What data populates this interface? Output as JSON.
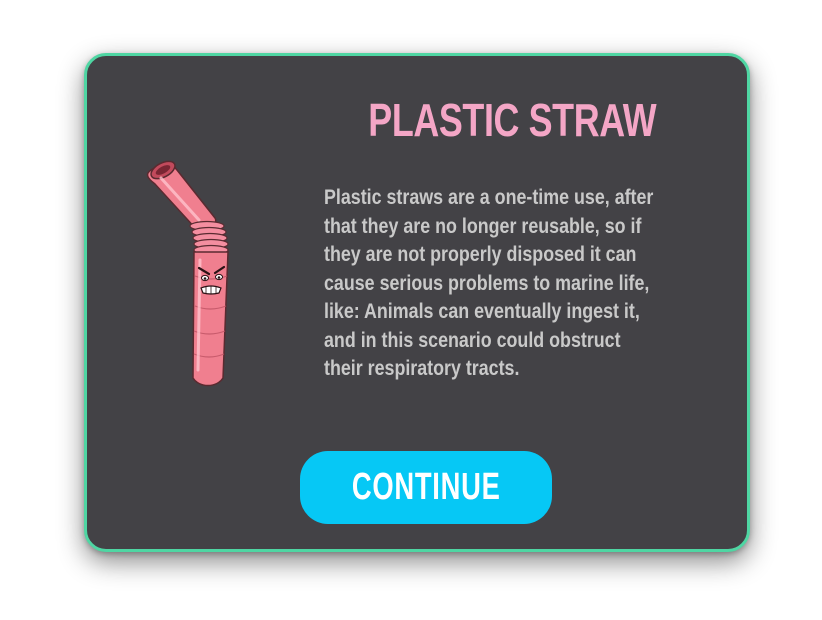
{
  "dialog": {
    "title": "PLASTIC STRAW",
    "description": "Plastic straws are a one-time use, after\nthat they are no longer reusable, so if\nthey are not properly disposed it can\ncause serious problems to marine life,\nlike: Animals can eventually  ingest it,\nand in this scenario could obstruct\ntheir respiratory tracts.",
    "continue_label": "CONTINUE",
    "mascot_icon": "angry-plastic-straw-icon"
  },
  "colors": {
    "panel_bg": "#434246",
    "panel_border": "#4fd6a3",
    "title": "#f4a6c6",
    "description": "#c9c9c9",
    "button_bg": "#06c8f5",
    "button_text": "#ffffff",
    "straw": "#f07f8f"
  }
}
